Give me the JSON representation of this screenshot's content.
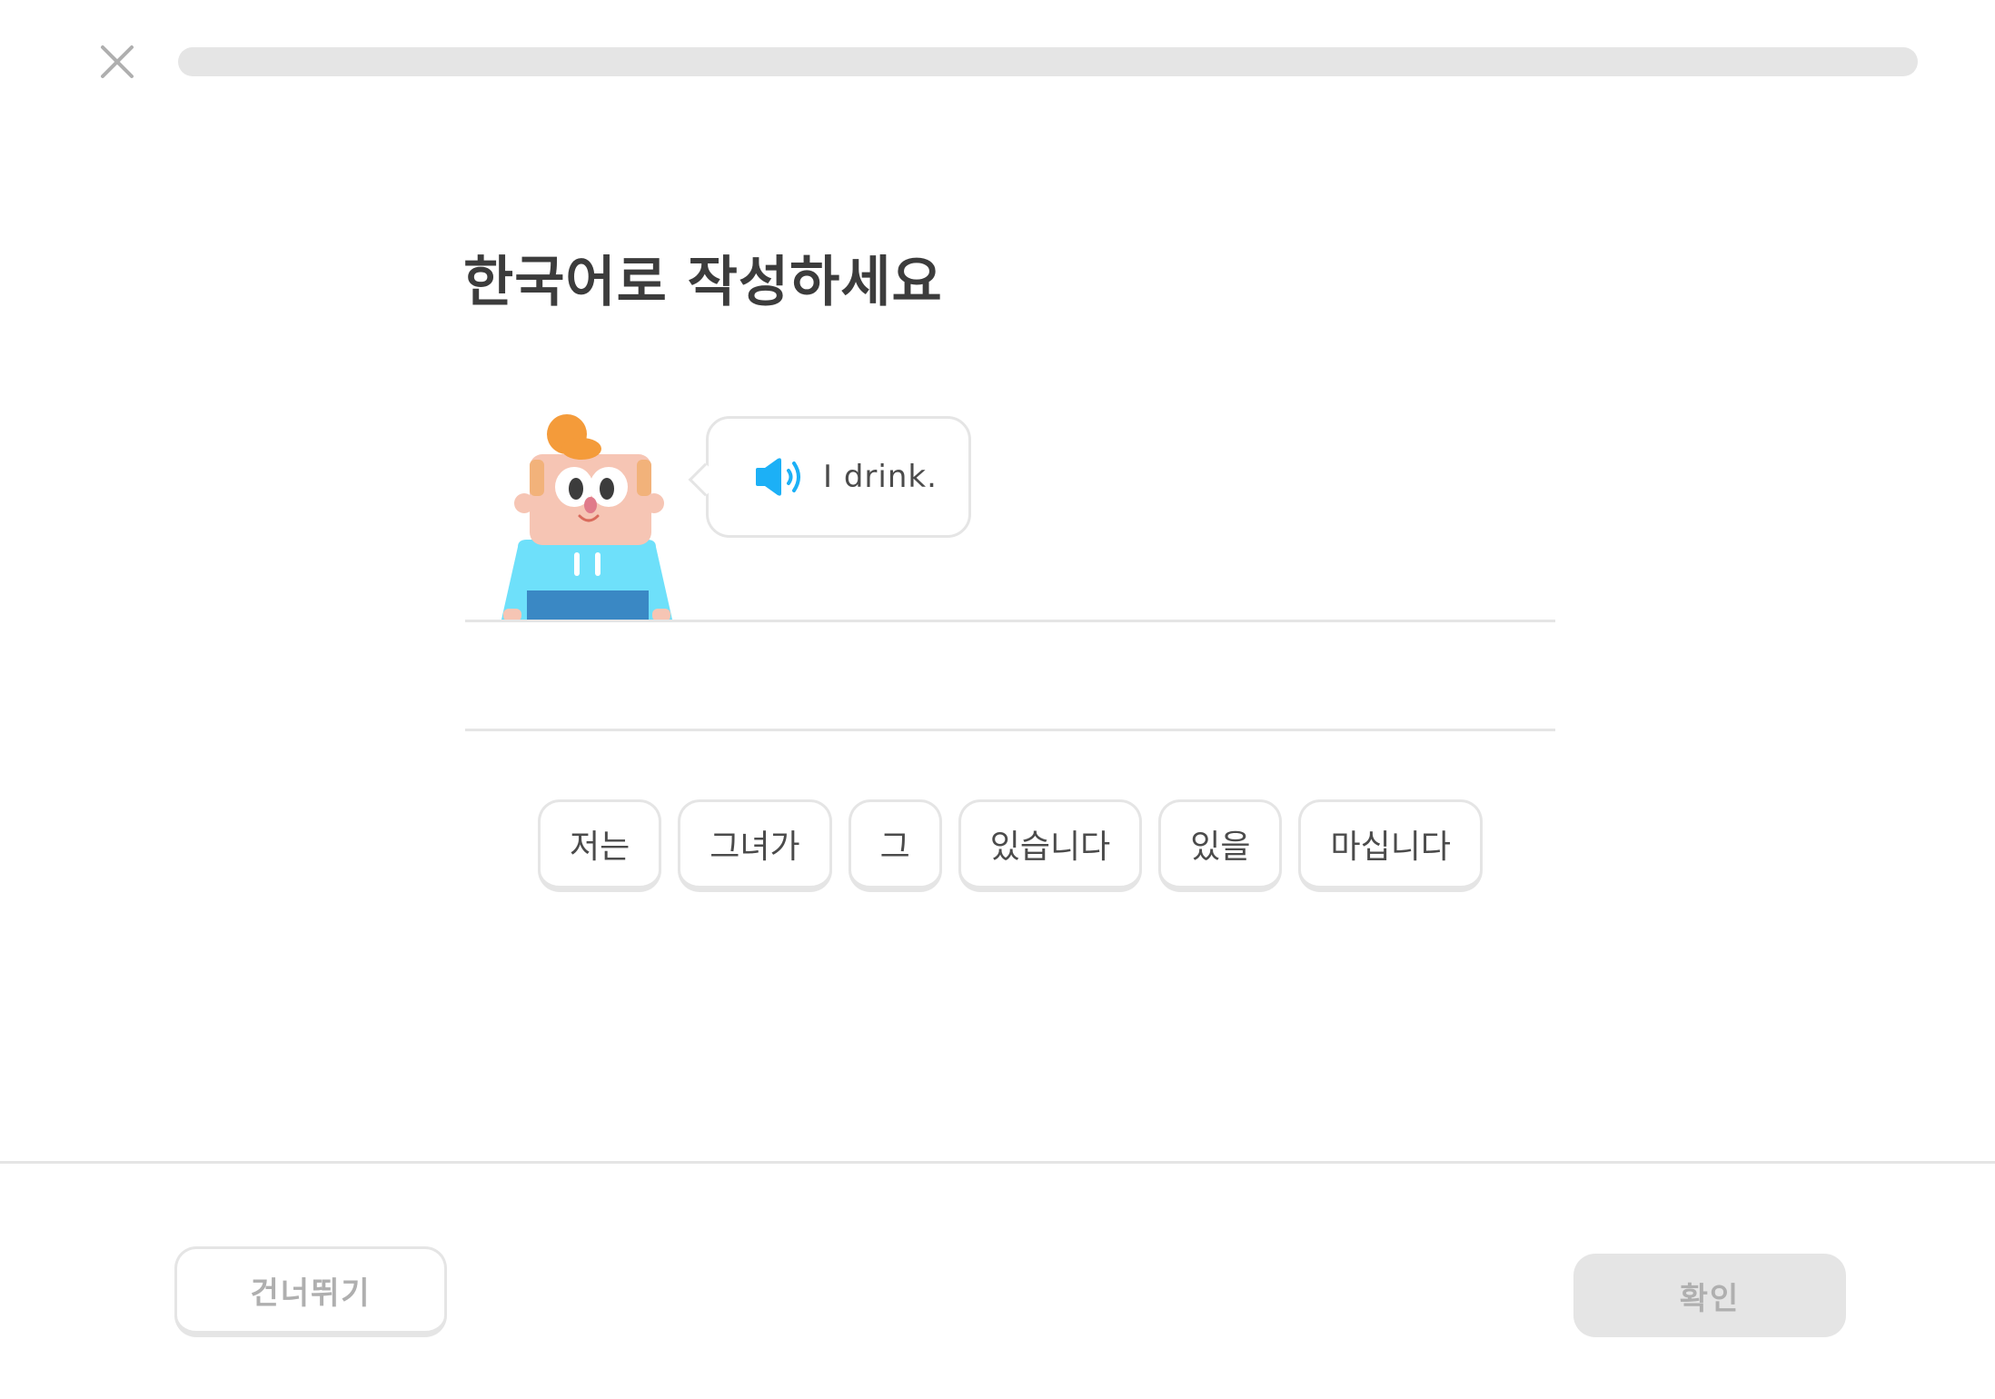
{
  "header": {
    "close_icon": "close-icon",
    "progress_fraction": 0.0
  },
  "prompt": {
    "title": "한국어로 작성하세요",
    "speech_text": "I drink.",
    "speaker_icon": "speaker-icon"
  },
  "word_bank": [
    {
      "label": "저는"
    },
    {
      "label": "그녀가"
    },
    {
      "label": "그"
    },
    {
      "label": "있습니다"
    },
    {
      "label": "있을"
    },
    {
      "label": "마십니다"
    }
  ],
  "footer": {
    "skip_label": "건너뛰기",
    "check_label": "확인"
  },
  "colors": {
    "border": "#e5e5e5",
    "text": "#3c3c3c",
    "disabled_text": "#afafaf",
    "speaker_blue": "#1cb0f6",
    "shirt_cyan": "#6ee0fa",
    "shirt_navy": "#3a88c4",
    "hair_orange": "#f49b3a",
    "skin": "#f6c5b4"
  }
}
